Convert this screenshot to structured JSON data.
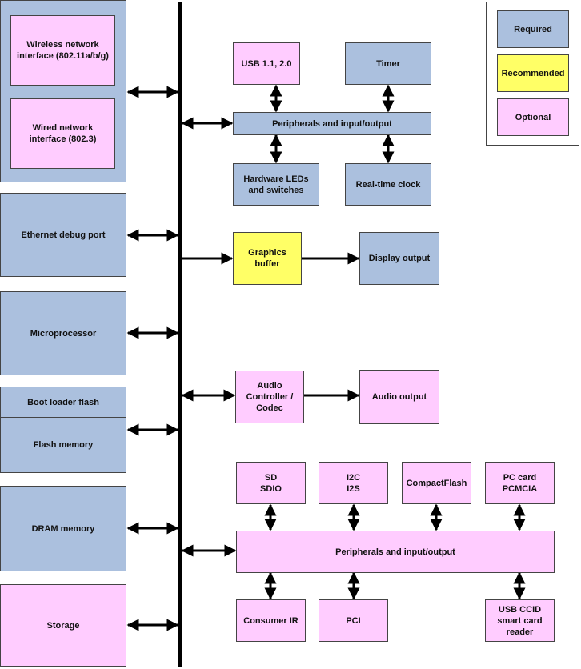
{
  "colors": {
    "required": "#abc0de",
    "recommended": "#ffff66",
    "optional": "#ffccff"
  },
  "legend": {
    "required": "Required",
    "recommended": "Recommended",
    "optional": "Optional"
  },
  "left": {
    "wireless": "Wireless network\ninterface (802.11a/b/g)",
    "wired": "Wired network\ninterface (802.3)",
    "ethernet": "Ethernet debug port",
    "microprocessor": "Microprocessor",
    "bootloader": "Boot loader flash",
    "flash": "Flash memory",
    "dram": "DRAM memory",
    "storage": "Storage"
  },
  "top": {
    "usb": "USB 1.1, 2.0",
    "timer": "Timer",
    "peripherals": "Peripherals and input/output",
    "leds": "Hardware LEDs\nand switches",
    "rtc": "Real-time clock"
  },
  "middle": {
    "graphics": "Graphics\nbuffer",
    "display": "Display output",
    "audio_ctrl": "Audio\nController /\nCodec",
    "audio_out": "Audio output"
  },
  "bottom": {
    "sd": "SD\nSDIO",
    "i2c": "I2C\nI2S",
    "cf": "CompactFlash",
    "pccard": "PC card\nPCMCIA",
    "peripherals": "Peripherals and input/output",
    "ir": "Consumer IR",
    "pci": "PCI",
    "ccid": "USB CCID\nsmart card\nreader"
  }
}
